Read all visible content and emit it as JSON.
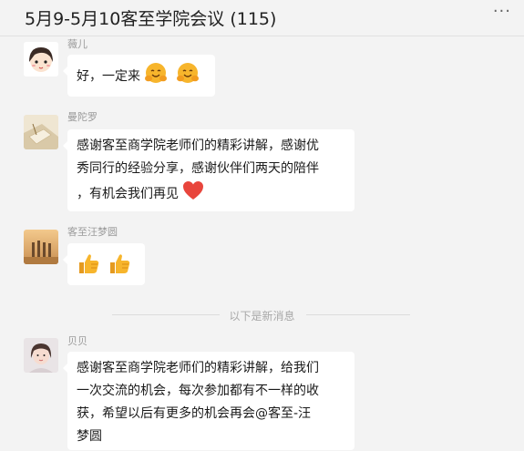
{
  "header": {
    "title": "5月9-5月10客至学院会议 (115)",
    "more_label": "···"
  },
  "messages": [
    {
      "sender": "薇儿",
      "text": "好，一定来",
      "emojis": [
        "hugging-face",
        "hugging-face"
      ]
    },
    {
      "sender": "曼陀罗",
      "lines": [
        "感谢客至商学院老师们的精彩讲解，感谢优",
        "秀同行的经验分享，感谢伙伴们两天的陪伴",
        "，有机会我们再见"
      ],
      "emojis": [
        "red-heart"
      ]
    },
    {
      "sender": "客至汪梦圆",
      "emojis": [
        "thumbs-up",
        "thumbs-up"
      ]
    },
    {
      "sender": "贝贝",
      "lines": [
        "感谢客至商学院老师们的精彩讲解，给我们",
        "一次交流的机会，每次参加都有不一样的收",
        "获，希望以后有更多的机会再会@客至-汪",
        "梦圆"
      ]
    }
  ],
  "divider": {
    "text": "以下是新消息"
  },
  "colors": {
    "background": "#f3f3f3",
    "bubble": "#ffffff",
    "sender": "#9a9a9a",
    "heart": "#e8453c",
    "emoji_yellow": "#f7b52c"
  }
}
